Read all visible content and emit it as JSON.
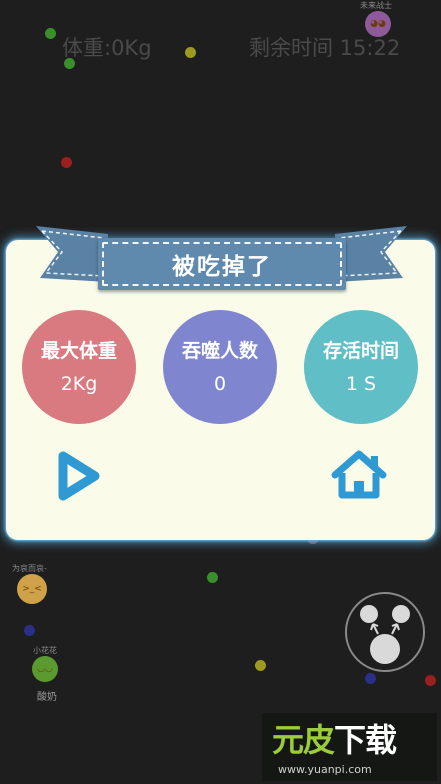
{
  "hud": {
    "weight": "体重:0Kg",
    "time_left": "剩余时间 15:22"
  },
  "background_players": [
    {
      "name": "未来战士",
      "color": "#8e5a99"
    },
    {
      "name": "为哀而哀-",
      "color": "#cfa24a"
    },
    {
      "name": "小花花",
      "color": "#5b9a2e"
    }
  ],
  "background_label": "酸奶",
  "dialog": {
    "title": "被吃掉了",
    "stats": [
      {
        "label": "最大体重",
        "value": "2Kg",
        "color": "#d87a80"
      },
      {
        "label": "吞噬人数",
        "value": "0",
        "color": "#7f86cf"
      },
      {
        "label": "存活时间",
        "value": "1 S",
        "color": "#5fbec6"
      }
    ],
    "play_icon": "play-triangle",
    "home_icon": "home-house",
    "accent": "#2f99d4"
  },
  "watermark": {
    "logo": "元皮下载",
    "url": "www.yuanpi.com"
  }
}
